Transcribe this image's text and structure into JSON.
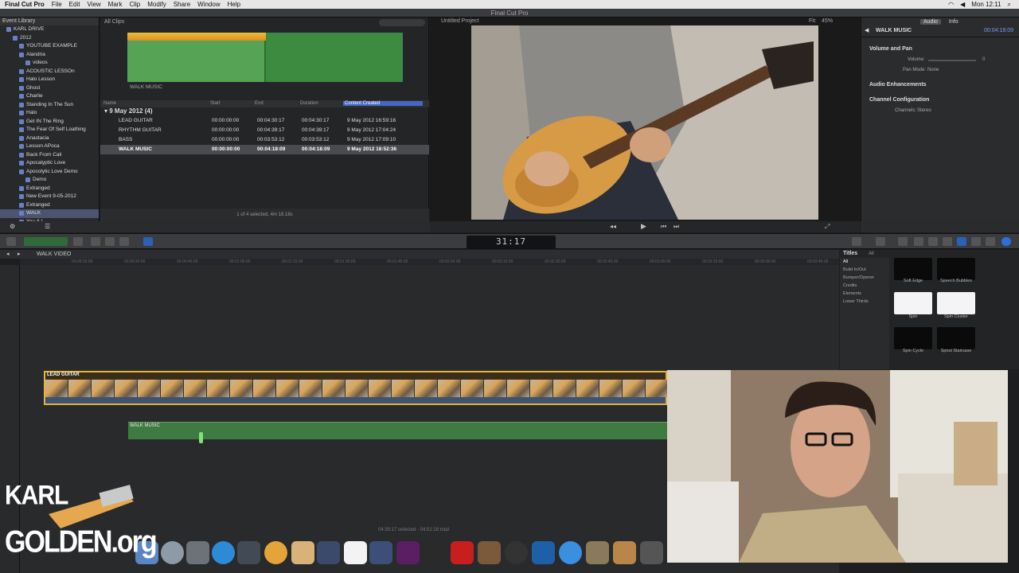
{
  "menubar": {
    "app": "Final Cut Pro",
    "items": [
      "File",
      "Edit",
      "View",
      "Mark",
      "Clip",
      "Modify",
      "Share",
      "Window",
      "Help"
    ],
    "clock": "Mon 12:11"
  },
  "window": {
    "title": "Final Cut Pro"
  },
  "library": {
    "header": "Event Library",
    "items": [
      {
        "label": "KARL DRIVE"
      },
      {
        "label": "2012"
      },
      {
        "label": "YOUTUBE EXAMPLE"
      },
      {
        "label": "Alandria"
      },
      {
        "label": "videos"
      },
      {
        "label": "ACOUSTIC LESSOn"
      },
      {
        "label": "Halo Lesson"
      },
      {
        "label": "Ghost"
      },
      {
        "label": "Charlie"
      },
      {
        "label": "Standing In The Sun"
      },
      {
        "label": "Halo"
      },
      {
        "label": "Get IN The Ring"
      },
      {
        "label": "The Fear Of Self Loathing"
      },
      {
        "label": "Anastacia"
      },
      {
        "label": "Lesson APoca"
      },
      {
        "label": "Back From Cali"
      },
      {
        "label": "Apocalyptic Love"
      },
      {
        "label": "Apocolytic Love Demo"
      },
      {
        "label": "Demo"
      },
      {
        "label": "Extranged"
      },
      {
        "label": "New Event 9-05-2012"
      },
      {
        "label": "Extranged"
      },
      {
        "label": "WALK"
      },
      {
        "label": "You & I"
      }
    ]
  },
  "browser": {
    "filter": "All Clips",
    "filmstrip_label": "WALK MUSIC",
    "columns": {
      "name": "Name",
      "start": "Start",
      "end": "End",
      "duration": "Duration",
      "created": "Content Created"
    },
    "group": "9 May 2012  (4)",
    "rows": [
      {
        "name": "LEAD GUITAR",
        "start": "00:00:00:00",
        "end": "00:04:30:17",
        "duration": "00:04:30:17",
        "created": "9 May 2012 16:59:16"
      },
      {
        "name": "RHYTHM GUITAR",
        "start": "00:00:00:00",
        "end": "00:04:39:17",
        "duration": "00:04:39:17",
        "created": "9 May 2012 17:04:24"
      },
      {
        "name": "BASS",
        "start": "00:00:00:00",
        "end": "00:03:53:12",
        "duration": "00:03:53:12",
        "created": "9 May 2012 17:09:10"
      },
      {
        "name": "WALK MUSIC",
        "start": "00:00:00:00",
        "end": "00:04:18:09",
        "duration": "00:04:18:09",
        "created": "9 May 2012 18:52:36"
      }
    ],
    "footer": "1 of 4 selected, 4m 18.18s"
  },
  "viewer": {
    "title": "Untitled Project",
    "fit_label": "Fit:",
    "zoom": "45%"
  },
  "inspector": {
    "tab_audio": "Audio",
    "tab_info": "Info",
    "clip_name": "WALK MUSIC",
    "clip_time": "00:04:18:09",
    "sections": {
      "volume_pan": "Volume and Pan",
      "volume_label": "Volume:",
      "volume_value": "0",
      "pan_mode_label": "Pan Mode:",
      "pan_mode_value": "None",
      "enhancements": "Audio Enhancements",
      "channel_config": "Channel Configuration",
      "channels_label": "Channels:",
      "channels_value": "Stereo"
    }
  },
  "toolbar": {
    "timecode": "31:17"
  },
  "timeline": {
    "project": "WALK VIDEO",
    "ruler": [
      "00:00:15:00",
      "00:00:30:00",
      "00:00:45:00",
      "00:01:00:00",
      "00:01:15:00",
      "00:01:30:00",
      "00:01:45:00",
      "00:02:00:00",
      "00:02:15:00",
      "00:02:30:00",
      "00:02:45:00",
      "00:03:00:00",
      "00:03:15:00",
      "00:03:30:00",
      "00:03:45:00"
    ],
    "storyline_label": "LEAD GUITAR",
    "music_label": "WALK MUSIC",
    "status": "04:30:17 selected - 04:51:18 total"
  },
  "titles": {
    "header": "Titles",
    "filter": "All",
    "categories": [
      "All",
      "Build In/Out",
      "Bumper/Opener",
      "Credits",
      "Elements",
      "Lower Thirds"
    ],
    "thumbs": [
      {
        "label": "Soft Edge",
        "white": false
      },
      {
        "label": "Speech Bubbles",
        "white": false
      },
      {
        "label": "Spin",
        "white": true
      },
      {
        "label": "Spin Cluster",
        "white": true
      },
      {
        "label": "Spin Cycle",
        "white": false
      },
      {
        "label": "Spiral Staircase",
        "white": false
      }
    ]
  },
  "logo": {
    "line1": "KARL",
    "line2": "GOLDEN.org"
  }
}
